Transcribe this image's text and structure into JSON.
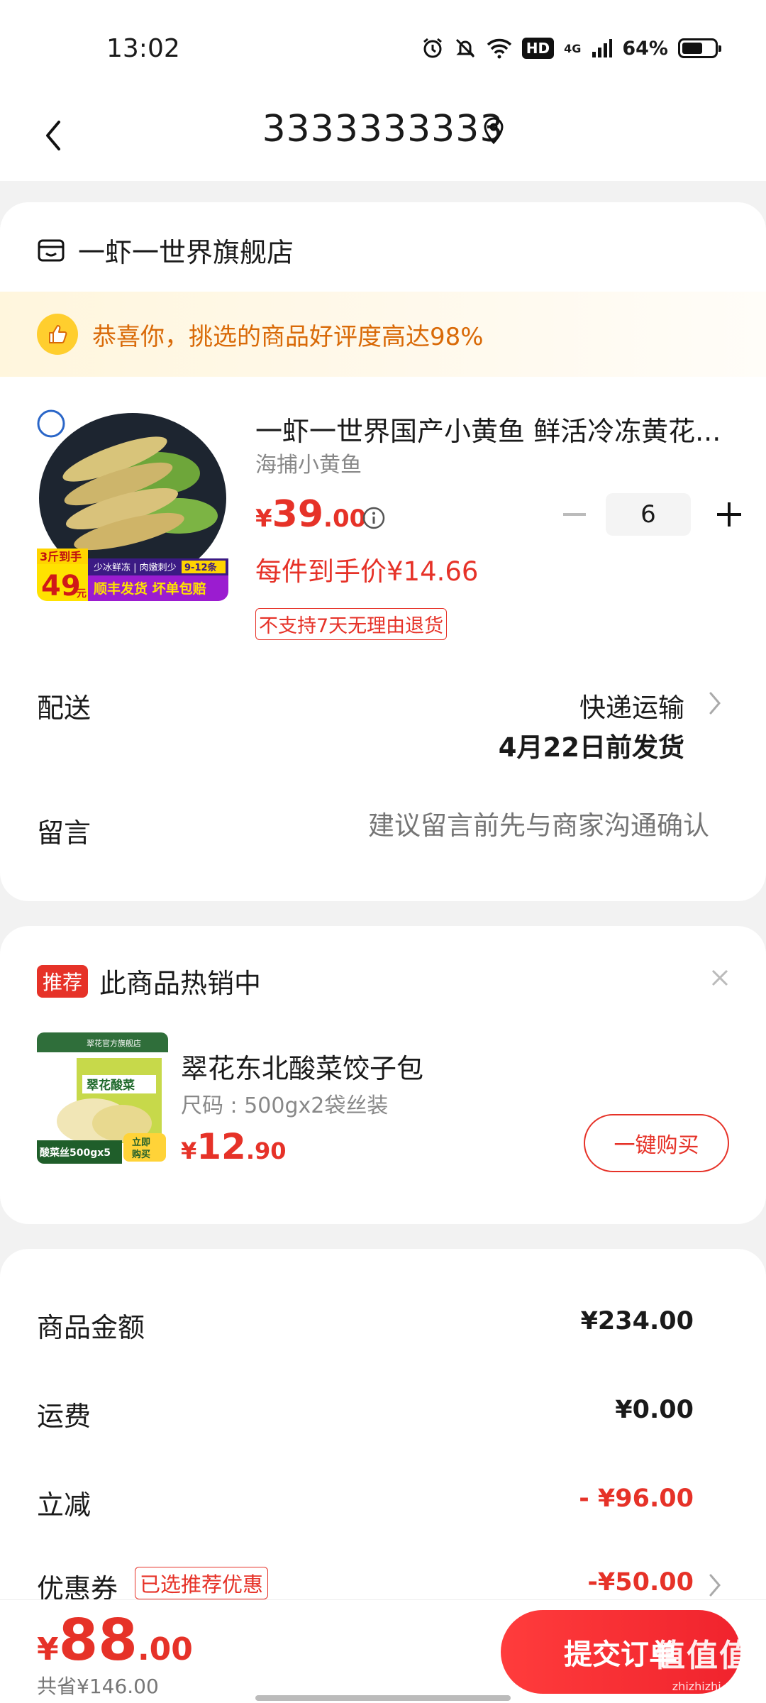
{
  "status_bar": {
    "time": "13:02",
    "network": "4G",
    "hd": "HD",
    "battery": "64%",
    "battery_level": 0.64
  },
  "header": {
    "title": "3333333333"
  },
  "store": {
    "name": "一虾一世界旗舰店"
  },
  "congrats": {
    "text": "恭喜你，挑选的商品好评度高达98%"
  },
  "product": {
    "title": "一虾一世界国产小黄鱼 鲜活冷冻黄花...",
    "subtitle": "海捕小黄鱼",
    "price_currency": "¥",
    "price_int": "39",
    "price_dec": ".00",
    "quantity": "6",
    "unit_price": "每件到手价¥14.66",
    "no_return": "不支持7天无理由退货",
    "image_texts": [
      "3斤到手",
      "49",
      "元",
      "少冰鲜冻",
      "肉嫩刺少",
      "9-12条",
      "顺丰发货",
      "坏单包赔"
    ]
  },
  "shipping": {
    "label": "配送",
    "method": "快递运输",
    "date": "4月22日前发货"
  },
  "message": {
    "label": "留言",
    "placeholder": "建议留言前先与商家沟通确认"
  },
  "recommend": {
    "badge": "推荐",
    "heading": "此商品热销中",
    "title": "翠花东北酸菜饺子包",
    "spec": "尺码 : 500gx2袋丝装",
    "price_currency": "¥",
    "price_int": "12",
    "price_dec": ".90",
    "button": "一键购买",
    "image_texts": [
      "翠花官方旗舰店",
      "翠花酸菜",
      "酸菜丝500gx5",
      "立即购买"
    ]
  },
  "summary": {
    "goods_label": "商品金额",
    "goods_value": "¥234.00",
    "freight_label": "运费",
    "freight_value": "¥0.00",
    "discount_label": "立减",
    "discount_value": "- ¥96.00",
    "coupon_label": "优惠券",
    "coupon_tag": "已选推荐优惠",
    "coupon_value": "-¥50.00"
  },
  "bottom": {
    "total_currency": "¥",
    "total_int": "88",
    "total_dec": ".00",
    "saved": "共省¥146.00",
    "submit": "提交订单",
    "watermark": "值值值",
    "watermark_sub": "zhizhizhi.com"
  },
  "colors": {
    "accent": "#e63228",
    "congrats_text": "#d96a08",
    "congrats_bg": "#fff6dd"
  }
}
